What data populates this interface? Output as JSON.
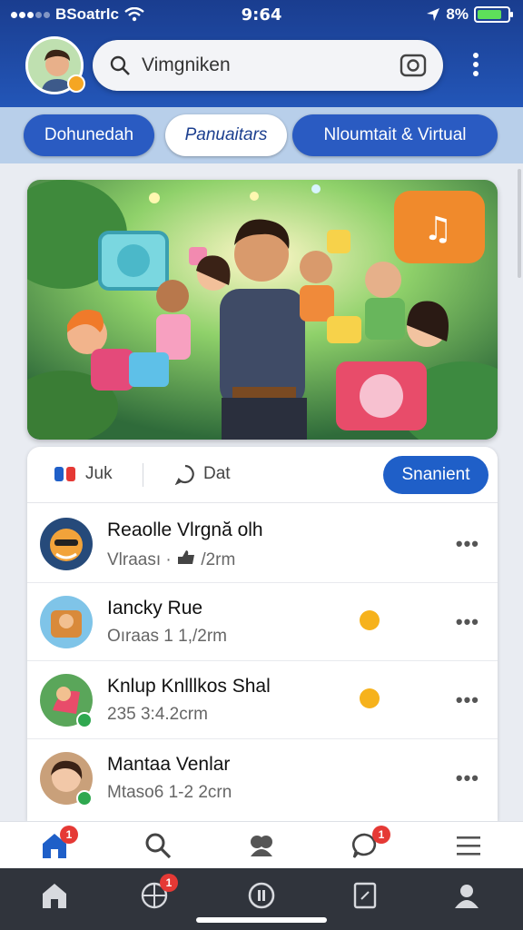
{
  "status": {
    "carrier": "BSoatrlc",
    "time": "9:64",
    "battery": "8%",
    "battery_level": 0.8
  },
  "header": {
    "search_placeholder": "Vimgniken"
  },
  "tabs": [
    {
      "label": "Dohunedah",
      "active": false
    },
    {
      "label": "Panuaitars",
      "active": true
    },
    {
      "label": "Nloumtait & Virtual",
      "active": false
    }
  ],
  "actions": {
    "like": "Juk",
    "comment": "Dat",
    "share": "Snanient"
  },
  "feed": [
    {
      "name": "Reaolle Vlrgnă olh",
      "sub": "Vlraası · ",
      "sub_tail": "/2rm",
      "avatar_color": "#f2a33a",
      "has_emoji": false
    },
    {
      "name": "Iancky Rue",
      "sub": "Oıraas 1 1,/2rm",
      "avatar_color": "#7fc4e8",
      "has_emoji": true
    },
    {
      "name": "Knlup Knlllkos Shal",
      "sub": "235  3:4.2crm",
      "avatar_color": "#5aa65a",
      "has_emoji": true
    },
    {
      "name": "Mantaa Venlar",
      "sub": "Mtaso6  1-2 2crn",
      "avatar_color": "#c9a07a",
      "has_emoji": false
    }
  ],
  "bottom_nav": {
    "home_badge": "1",
    "chat_badge": "1",
    "sys_badge": "1"
  }
}
